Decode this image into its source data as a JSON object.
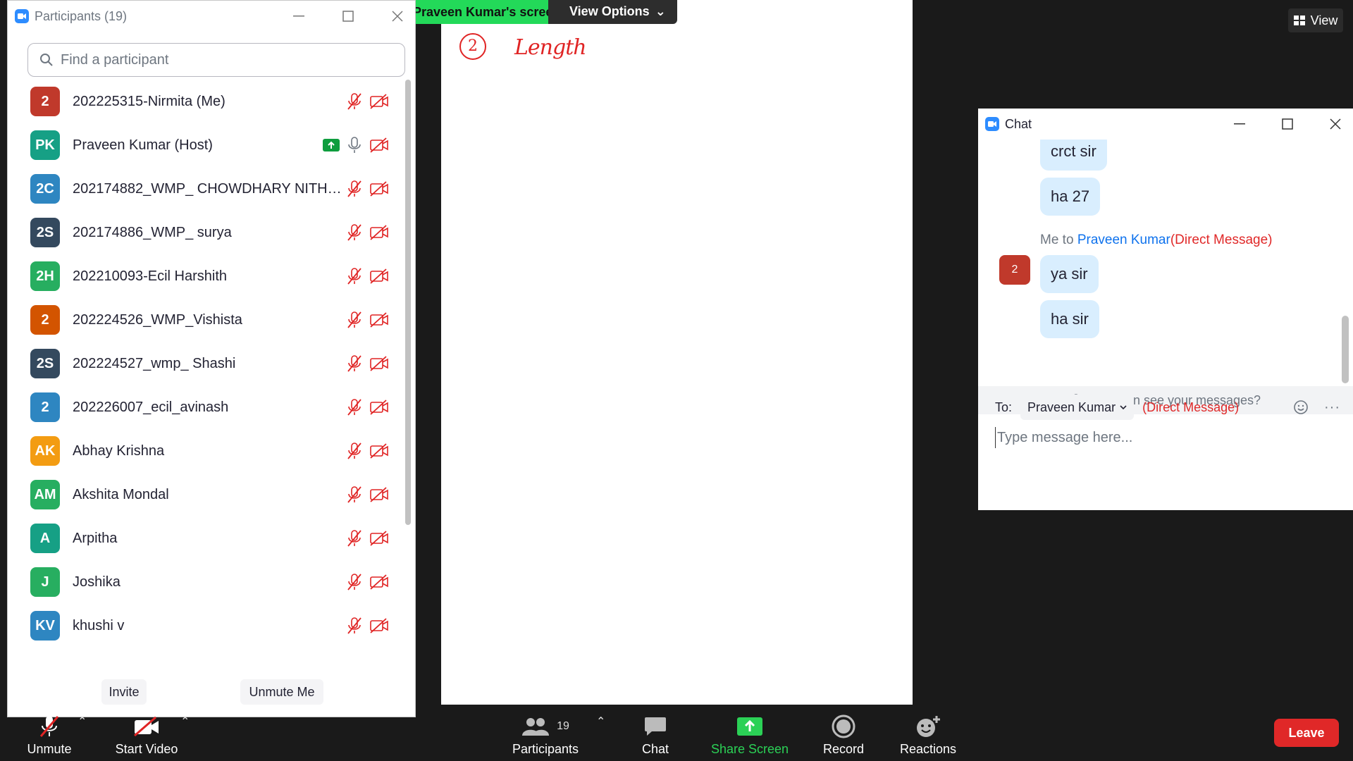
{
  "participants_window": {
    "title": "Participants (19)",
    "search_placeholder": "Find a participant",
    "participants": [
      {
        "initials": "2",
        "name": "202225315-Nirmita (Me)",
        "color": "#c0392b",
        "sharing": false
      },
      {
        "initials": "PK",
        "name": "Praveen Kumar (Host)",
        "color": "#16a085",
        "sharing": true
      },
      {
        "initials": "2C",
        "name": "202174882_WMP_ CHOWDHARY NITHYA ...",
        "color": "#2e86c1",
        "sharing": false
      },
      {
        "initials": "2S",
        "name": "202174886_WMP_ surya",
        "color": "#34495e",
        "sharing": false
      },
      {
        "initials": "2H",
        "name": "202210093-Ecil Harshith",
        "color": "#27ae60",
        "sharing": false
      },
      {
        "initials": "2",
        "name": "202224526_WMP_Vishista",
        "color": "#d35400",
        "sharing": false
      },
      {
        "initials": "2S",
        "name": "202224527_wmp_ Shashi",
        "color": "#34495e",
        "sharing": false
      },
      {
        "initials": "2",
        "name": "202226007_ecil_avinash",
        "color": "#2e86c1",
        "sharing": false
      },
      {
        "initials": "AK",
        "name": "Abhay Krishna",
        "color": "#f39c12",
        "sharing": false
      },
      {
        "initials": "AM",
        "name": "Akshita Mondal",
        "color": "#27ae60",
        "sharing": false
      },
      {
        "initials": "A",
        "name": "Arpitha",
        "color": "#16a085",
        "sharing": false
      },
      {
        "initials": "J",
        "name": "Joshika",
        "color": "#27ae60",
        "sharing": false
      },
      {
        "initials": "KV",
        "name": "khushi v",
        "color": "#2e86c1",
        "sharing": false
      }
    ],
    "invite_label": "Invite",
    "unmute_me_label": "Unmute Me"
  },
  "share_banner": {
    "sharer_text": "Praveen Kumar's screen",
    "view_options_label": "View Options"
  },
  "annotation": {
    "circle_number": "2",
    "word": "Length"
  },
  "view_button": {
    "label": "View"
  },
  "chat_window": {
    "title": "Chat",
    "messages_before": [
      "crct sir",
      "ha 27"
    ],
    "sender_prefix": "Me to ",
    "recipient": "Praveen Kumar",
    "dm_tag": "(Direct Message)",
    "my_avatar": "2",
    "messages_mine": [
      "ya sir",
      "ha sir"
    ],
    "who_can_see": "Who can see your messages?",
    "to_label": "To:",
    "to_value": "Praveen Kumar",
    "to_dm_tag": "(Direct Message)",
    "input_placeholder": "Type message here..."
  },
  "toolbar": {
    "unmute": "Unmute",
    "start_video": "Start Video",
    "participants": "Participants",
    "participants_count": "19",
    "chat": "Chat",
    "share_screen": "Share Screen",
    "record": "Record",
    "reactions": "Reactions",
    "leave": "Leave"
  },
  "colors": {
    "accent_blue": "#2d8cff",
    "share_green": "#23d959",
    "leave_red": "#e02828",
    "muted_red": "#e02424"
  }
}
